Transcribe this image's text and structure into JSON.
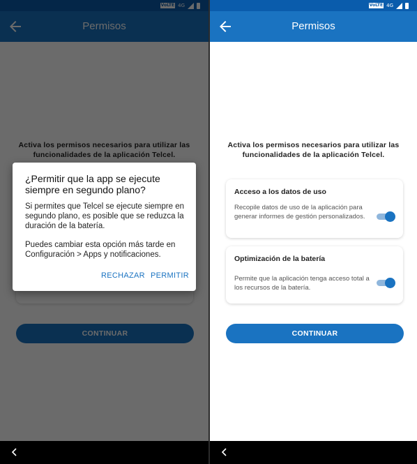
{
  "status_bar": {
    "volte": "VoLTE",
    "network": "4G"
  },
  "app_bar": {
    "title": "Permisos"
  },
  "intro_text": "Activa los permisos necesarios para utilizar las funcionalidades de la aplicación Telcel.",
  "cards": [
    {
      "title": "Acceso a los datos de uso",
      "description": "Recopile datos de uso de la aplicación para generar informes de gestión personalizados.",
      "enabled": true
    },
    {
      "title": "Optimización de la batería",
      "description": "Permite que la aplicación tenga acceso total a los recursos de la batería.",
      "enabled": true
    }
  ],
  "continue_label": "CONTINUAR",
  "dialog": {
    "title": "¿Permitir que la app se ejecute siempre en segundo plano?",
    "message": "Si permites que Telcel se ejecute siempre en segundo plano, es posible que se reduzca la duración de la batería.",
    "hint": "Puedes cambiar esta opción más tarde en Configuración > Apps y notificaciones.",
    "deny_label": "RECHAZAR",
    "allow_label": "PERMITIR"
  },
  "colors": {
    "primary": "#1a73c1",
    "status_bar": "#0a5cac",
    "toggle_track": "#8fb6dc"
  },
  "icons": {
    "back": "arrow-left-icon",
    "nav_back": "chevron-left-icon"
  }
}
